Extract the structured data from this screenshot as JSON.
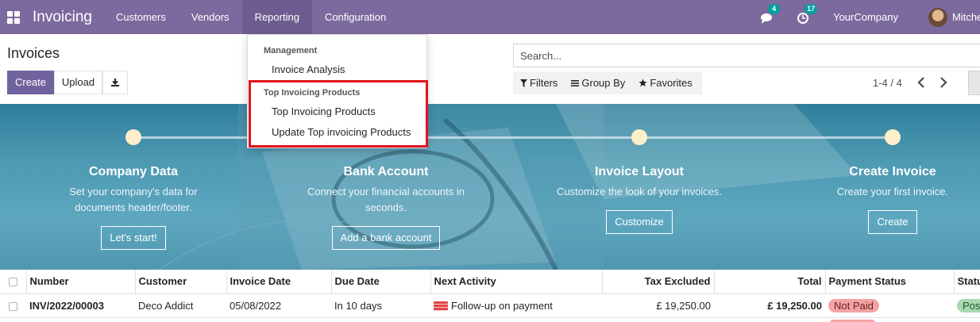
{
  "navbar": {
    "brand": "Invoicing",
    "menu": [
      "Customers",
      "Vendors",
      "Reporting",
      "Configuration"
    ],
    "active_menu": "Reporting",
    "messages_badge": "4",
    "activities_badge": "17",
    "company": "YourCompany",
    "user": "Mitchell Admin",
    "color": "#7c6a9e"
  },
  "page": {
    "title": "Invoices",
    "create_label": "Create",
    "upload_label": "Upload",
    "search_placeholder": "Search...",
    "filters_label": "Filters",
    "groupby_label": "Group By",
    "favorites_label": "Favorites",
    "pager": "1-4 / 4",
    "accent": "#71639e"
  },
  "dropdown": {
    "section1_header": "Management",
    "section1_item": "Invoice Analysis",
    "section2_header": "Top Invoicing Products",
    "section2_items": [
      "Top Invoicing Products",
      "Update Top invoicing Products"
    ],
    "highlight_color": "#e2131b"
  },
  "onboarding": {
    "steps": [
      {
        "title": "Company Data",
        "desc": "Set your company's data for documents header/footer.",
        "button": "Let's start!"
      },
      {
        "title": "Bank Account",
        "desc": "Connect your financial accounts in seconds.",
        "button": "Add a bank account"
      },
      {
        "title": "Invoice Layout",
        "desc": "Customize the look of your invoices.",
        "button": "Customize"
      },
      {
        "title": "Create Invoice",
        "desc": "Create your first invoice.",
        "button": "Create"
      }
    ]
  },
  "table": {
    "columns": [
      "Number",
      "Customer",
      "Invoice Date",
      "Due Date",
      "Next Activity",
      "Tax Excluded",
      "Total",
      "Payment Status",
      "Status"
    ],
    "rows": [
      {
        "number": "INV/2022/00003",
        "customer": "Deco Addict",
        "invoice_date": "05/08/2022",
        "due_date": "In 10 days",
        "activity": "Follow-up on payment",
        "tax_excluded": "£ 19,250.00",
        "total": "£ 19,250.00",
        "payment_status": "Not Paid",
        "status": "Posted"
      }
    ]
  }
}
